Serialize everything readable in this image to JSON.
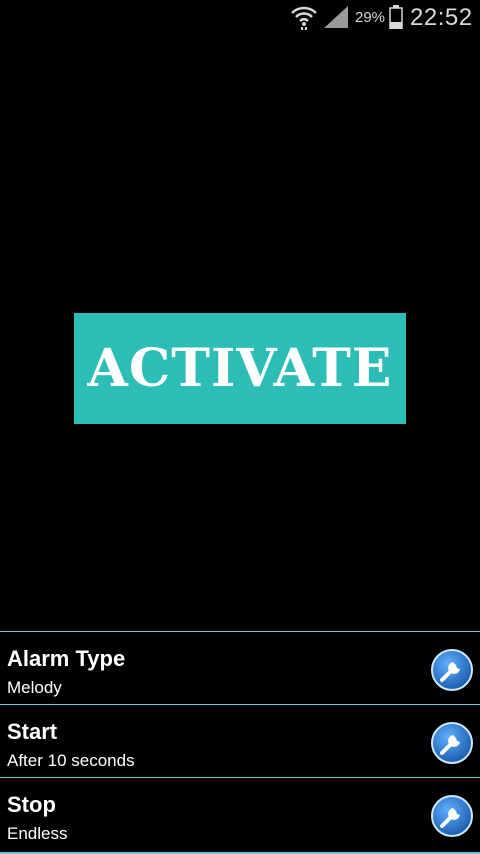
{
  "status_bar": {
    "battery_percent": "29%",
    "time": "22:52",
    "icons": [
      "wifi-icon",
      "signal-icon",
      "battery-icon"
    ]
  },
  "main": {
    "activate_label": "ACTIVATE",
    "activate_color": "#2cbdb7"
  },
  "settings": [
    {
      "title": "Alarm Type",
      "value": "Melody",
      "icon": "wrench-icon"
    },
    {
      "title": "Start",
      "value": "After 10 seconds",
      "icon": "wrench-icon"
    },
    {
      "title": "Stop",
      "value": "Endless",
      "icon": "wrench-icon"
    }
  ],
  "colors": {
    "background": "#000000",
    "divider": "#66c6d6",
    "icon_blue": "#2a7fd0"
  }
}
